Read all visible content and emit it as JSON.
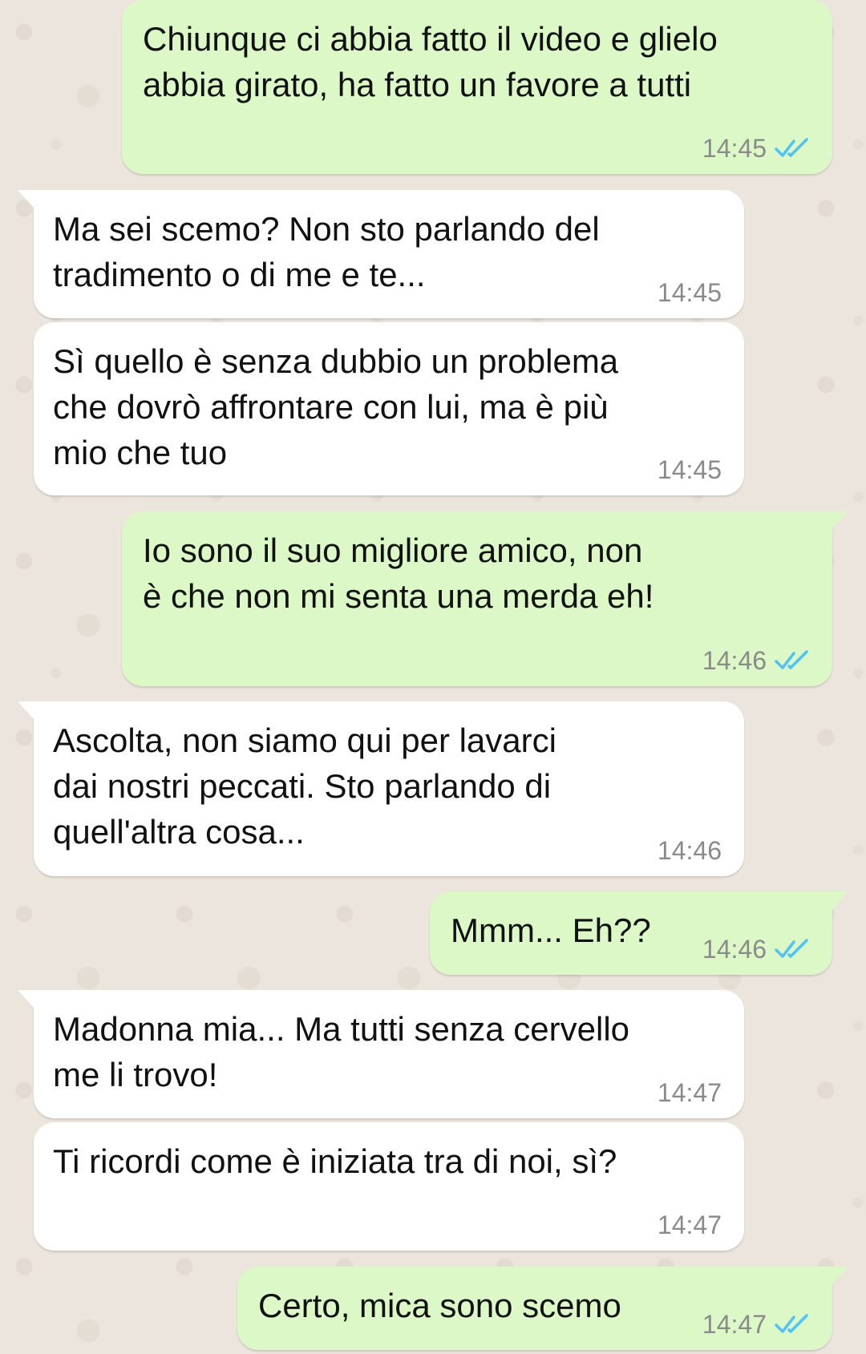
{
  "colors": {
    "chat_background": "#ece5dd",
    "incoming_bubble": "#ffffff",
    "outgoing_bubble": "#dcf8c6",
    "timestamp": "#8a8a8a",
    "read_ticks": "#4fc3f7"
  },
  "messages": [
    {
      "direction": "outgoing",
      "text": "Chiunque ci abbia fatto il video e glielo\nabbia girato, ha fatto un favore a tutti",
      "time": "14:45",
      "status_icon": "double-check-read-icon"
    },
    {
      "direction": "incoming",
      "text": "Ma sei scemo? Non sto parlando del\ntradimento o di me e te...",
      "time": "14:45"
    },
    {
      "direction": "incoming",
      "text": "Sì quello è senza dubbio un problema\nche dovrò affrontare con lui, ma è più\nmio che tuo",
      "time": "14:45"
    },
    {
      "direction": "outgoing",
      "text": "Io sono il suo migliore amico, non\nè che non mi senta una merda eh!",
      "time": "14:46",
      "status_icon": "double-check-read-icon"
    },
    {
      "direction": "incoming",
      "text": "Ascolta, non siamo qui per lavarci\ndai nostri peccati. Sto parlando di\nquell'altra cosa...",
      "time": "14:46"
    },
    {
      "direction": "outgoing",
      "text": "Mmm... Eh??",
      "time": "14:46",
      "status_icon": "double-check-read-icon"
    },
    {
      "direction": "incoming",
      "text": "Madonna mia... Ma tutti senza cervello\nme li trovo!",
      "time": "14:47"
    },
    {
      "direction": "incoming",
      "text": "Ti ricordi come è iniziata tra di noi, sì?",
      "time": "14:47"
    },
    {
      "direction": "outgoing",
      "text": "Certo, mica sono scemo",
      "time": "14:47",
      "status_icon": "double-check-read-icon"
    }
  ]
}
